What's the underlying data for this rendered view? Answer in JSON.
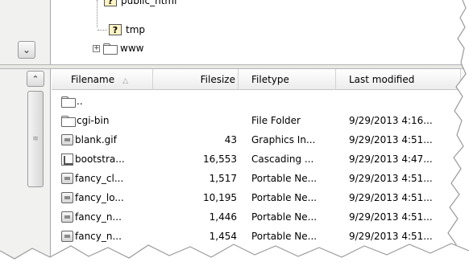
{
  "tree": {
    "nodes": [
      {
        "label": "public_html",
        "icon": "question-icon"
      },
      {
        "label": "tmp",
        "icon": "question-icon"
      },
      {
        "label": "www",
        "icon": "folder-icon",
        "expander": "+"
      }
    ],
    "scroll_down_glyph": "⌄"
  },
  "list": {
    "scroll_up_glyph": "⌃",
    "thumb_grip": "≡",
    "columns": [
      {
        "label": "Filename",
        "sort": "△"
      },
      {
        "label": "Filesize"
      },
      {
        "label": "Filetype"
      },
      {
        "label": "Last modified"
      }
    ],
    "rows": [
      {
        "name": "..",
        "icon": "folder-icon",
        "size": "",
        "type": "",
        "modified": ""
      },
      {
        "name": "cgi-bin",
        "icon": "folder-icon",
        "size": "",
        "type": "File Folder",
        "modified": "9/29/2013 4:16..."
      },
      {
        "name": "blank.gif",
        "icon": "image-file-icon",
        "size": "43",
        "type": "Graphics In...",
        "modified": "9/29/2013 4:51..."
      },
      {
        "name": "bootstra...",
        "icon": "css-file-icon",
        "size": "16,553",
        "type": "Cascading ...",
        "modified": "9/29/2013 4:47..."
      },
      {
        "name": "fancy_cl...",
        "icon": "image-file-icon",
        "size": "1,517",
        "type": "Portable Ne...",
        "modified": "9/29/2013 4:51..."
      },
      {
        "name": "fancy_lo...",
        "icon": "image-file-icon",
        "size": "10,195",
        "type": "Portable Ne...",
        "modified": "9/29/2013 4:51..."
      },
      {
        "name": "fancy_n...",
        "icon": "image-file-icon",
        "size": "1,446",
        "type": "Portable Ne...",
        "modified": "9/29/2013 4:51..."
      },
      {
        "name": "fancy_n...",
        "icon": "image-file-icon",
        "size": "1,454",
        "type": "Portable Ne...",
        "modified": "9/29/2013 4:51..."
      }
    ]
  }
}
